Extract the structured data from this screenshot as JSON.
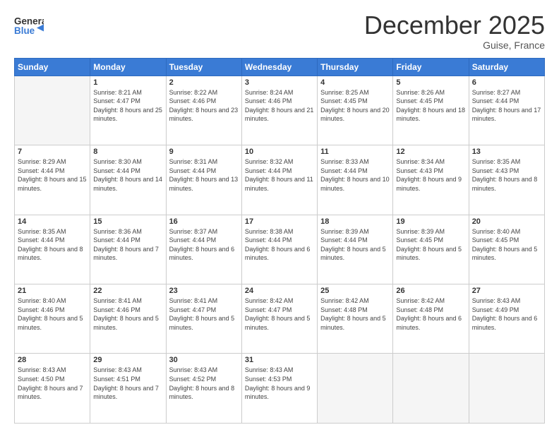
{
  "header": {
    "logo_general": "General",
    "logo_blue": "Blue",
    "month_title": "December 2025",
    "location": "Guise, France"
  },
  "weekdays": [
    "Sunday",
    "Monday",
    "Tuesday",
    "Wednesday",
    "Thursday",
    "Friday",
    "Saturday"
  ],
  "weeks": [
    [
      {
        "day": "",
        "sunrise": "",
        "sunset": "",
        "daylight": ""
      },
      {
        "day": "1",
        "sunrise": "Sunrise: 8:21 AM",
        "sunset": "Sunset: 4:47 PM",
        "daylight": "Daylight: 8 hours and 25 minutes."
      },
      {
        "day": "2",
        "sunrise": "Sunrise: 8:22 AM",
        "sunset": "Sunset: 4:46 PM",
        "daylight": "Daylight: 8 hours and 23 minutes."
      },
      {
        "day": "3",
        "sunrise": "Sunrise: 8:24 AM",
        "sunset": "Sunset: 4:46 PM",
        "daylight": "Daylight: 8 hours and 21 minutes."
      },
      {
        "day": "4",
        "sunrise": "Sunrise: 8:25 AM",
        "sunset": "Sunset: 4:45 PM",
        "daylight": "Daylight: 8 hours and 20 minutes."
      },
      {
        "day": "5",
        "sunrise": "Sunrise: 8:26 AM",
        "sunset": "Sunset: 4:45 PM",
        "daylight": "Daylight: 8 hours and 18 minutes."
      },
      {
        "day": "6",
        "sunrise": "Sunrise: 8:27 AM",
        "sunset": "Sunset: 4:44 PM",
        "daylight": "Daylight: 8 hours and 17 minutes."
      }
    ],
    [
      {
        "day": "7",
        "sunrise": "Sunrise: 8:29 AM",
        "sunset": "Sunset: 4:44 PM",
        "daylight": "Daylight: 8 hours and 15 minutes."
      },
      {
        "day": "8",
        "sunrise": "Sunrise: 8:30 AM",
        "sunset": "Sunset: 4:44 PM",
        "daylight": "Daylight: 8 hours and 14 minutes."
      },
      {
        "day": "9",
        "sunrise": "Sunrise: 8:31 AM",
        "sunset": "Sunset: 4:44 PM",
        "daylight": "Daylight: 8 hours and 13 minutes."
      },
      {
        "day": "10",
        "sunrise": "Sunrise: 8:32 AM",
        "sunset": "Sunset: 4:44 PM",
        "daylight": "Daylight: 8 hours and 11 minutes."
      },
      {
        "day": "11",
        "sunrise": "Sunrise: 8:33 AM",
        "sunset": "Sunset: 4:44 PM",
        "daylight": "Daylight: 8 hours and 10 minutes."
      },
      {
        "day": "12",
        "sunrise": "Sunrise: 8:34 AM",
        "sunset": "Sunset: 4:43 PM",
        "daylight": "Daylight: 8 hours and 9 minutes."
      },
      {
        "day": "13",
        "sunrise": "Sunrise: 8:35 AM",
        "sunset": "Sunset: 4:43 PM",
        "daylight": "Daylight: 8 hours and 8 minutes."
      }
    ],
    [
      {
        "day": "14",
        "sunrise": "Sunrise: 8:35 AM",
        "sunset": "Sunset: 4:44 PM",
        "daylight": "Daylight: 8 hours and 8 minutes."
      },
      {
        "day": "15",
        "sunrise": "Sunrise: 8:36 AM",
        "sunset": "Sunset: 4:44 PM",
        "daylight": "Daylight: 8 hours and 7 minutes."
      },
      {
        "day": "16",
        "sunrise": "Sunrise: 8:37 AM",
        "sunset": "Sunset: 4:44 PM",
        "daylight": "Daylight: 8 hours and 6 minutes."
      },
      {
        "day": "17",
        "sunrise": "Sunrise: 8:38 AM",
        "sunset": "Sunset: 4:44 PM",
        "daylight": "Daylight: 8 hours and 6 minutes."
      },
      {
        "day": "18",
        "sunrise": "Sunrise: 8:39 AM",
        "sunset": "Sunset: 4:44 PM",
        "daylight": "Daylight: 8 hours and 5 minutes."
      },
      {
        "day": "19",
        "sunrise": "Sunrise: 8:39 AM",
        "sunset": "Sunset: 4:45 PM",
        "daylight": "Daylight: 8 hours and 5 minutes."
      },
      {
        "day": "20",
        "sunrise": "Sunrise: 8:40 AM",
        "sunset": "Sunset: 4:45 PM",
        "daylight": "Daylight: 8 hours and 5 minutes."
      }
    ],
    [
      {
        "day": "21",
        "sunrise": "Sunrise: 8:40 AM",
        "sunset": "Sunset: 4:46 PM",
        "daylight": "Daylight: 8 hours and 5 minutes."
      },
      {
        "day": "22",
        "sunrise": "Sunrise: 8:41 AM",
        "sunset": "Sunset: 4:46 PM",
        "daylight": "Daylight: 8 hours and 5 minutes."
      },
      {
        "day": "23",
        "sunrise": "Sunrise: 8:41 AM",
        "sunset": "Sunset: 4:47 PM",
        "daylight": "Daylight: 8 hours and 5 minutes."
      },
      {
        "day": "24",
        "sunrise": "Sunrise: 8:42 AM",
        "sunset": "Sunset: 4:47 PM",
        "daylight": "Daylight: 8 hours and 5 minutes."
      },
      {
        "day": "25",
        "sunrise": "Sunrise: 8:42 AM",
        "sunset": "Sunset: 4:48 PM",
        "daylight": "Daylight: 8 hours and 5 minutes."
      },
      {
        "day": "26",
        "sunrise": "Sunrise: 8:42 AM",
        "sunset": "Sunset: 4:48 PM",
        "daylight": "Daylight: 8 hours and 6 minutes."
      },
      {
        "day": "27",
        "sunrise": "Sunrise: 8:43 AM",
        "sunset": "Sunset: 4:49 PM",
        "daylight": "Daylight: 8 hours and 6 minutes."
      }
    ],
    [
      {
        "day": "28",
        "sunrise": "Sunrise: 8:43 AM",
        "sunset": "Sunset: 4:50 PM",
        "daylight": "Daylight: 8 hours and 7 minutes."
      },
      {
        "day": "29",
        "sunrise": "Sunrise: 8:43 AM",
        "sunset": "Sunset: 4:51 PM",
        "daylight": "Daylight: 8 hours and 7 minutes."
      },
      {
        "day": "30",
        "sunrise": "Sunrise: 8:43 AM",
        "sunset": "Sunset: 4:52 PM",
        "daylight": "Daylight: 8 hours and 8 minutes."
      },
      {
        "day": "31",
        "sunrise": "Sunrise: 8:43 AM",
        "sunset": "Sunset: 4:53 PM",
        "daylight": "Daylight: 8 hours and 9 minutes."
      },
      {
        "day": "",
        "sunrise": "",
        "sunset": "",
        "daylight": ""
      },
      {
        "day": "",
        "sunrise": "",
        "sunset": "",
        "daylight": ""
      },
      {
        "day": "",
        "sunrise": "",
        "sunset": "",
        "daylight": ""
      }
    ]
  ]
}
